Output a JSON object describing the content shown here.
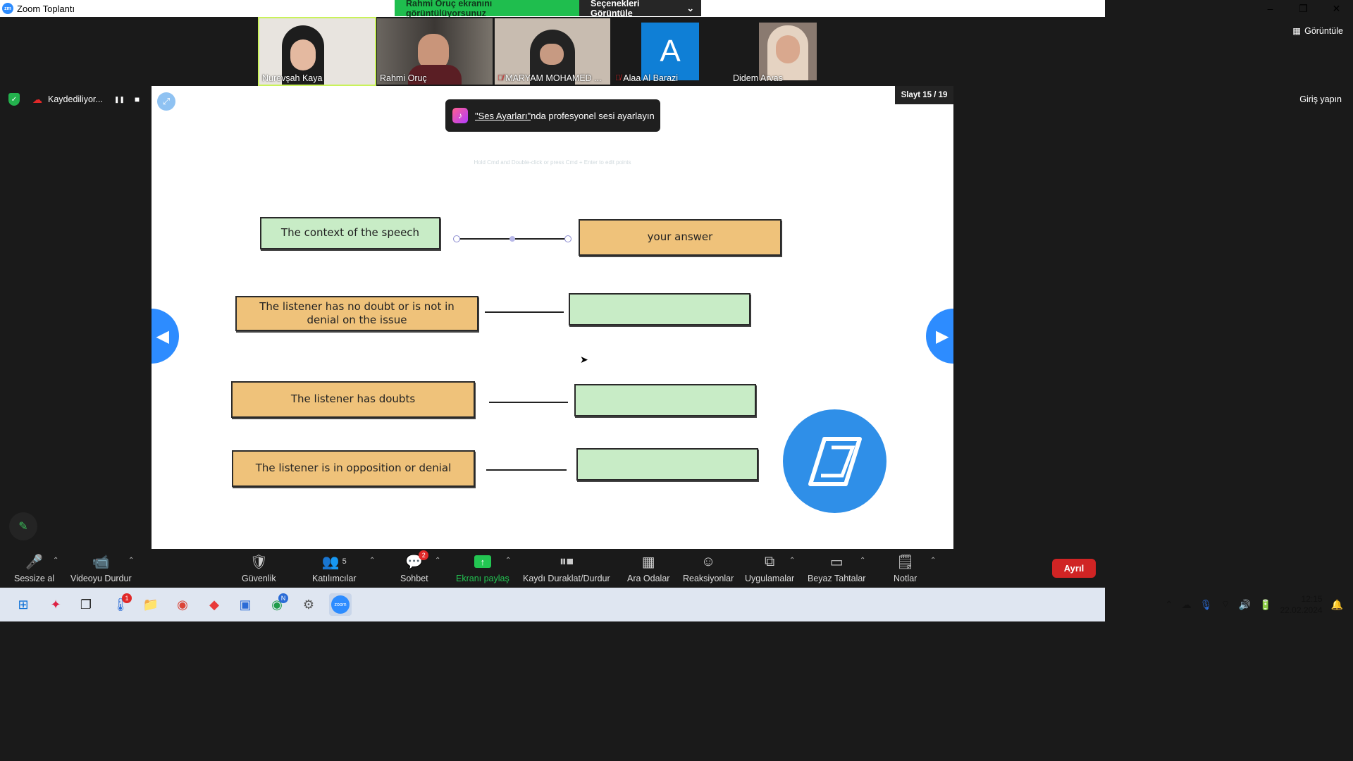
{
  "window": {
    "title": "Zoom Toplantı",
    "app_icon": "zm"
  },
  "share_banner": {
    "status": "Rahmi Oruç ekranını görüntülüyorsunuz",
    "options_label": "Seçenekleri Görüntüle"
  },
  "window_controls": {
    "minimize": "–",
    "restore": "❐",
    "close": "✕"
  },
  "participants": [
    {
      "name": "Nurevşah Kaya",
      "muted": false,
      "active": true,
      "tile_color": "#e8e4df"
    },
    {
      "name": "Rahmi Oruç",
      "muted": false,
      "active": false,
      "tile_color": "#5a5550"
    },
    {
      "name": "MARYAM MOHAMED ...",
      "muted": true,
      "active": false,
      "tile_color": "#b8a89c"
    },
    {
      "name": "Alaa Al Barazi",
      "muted": true,
      "active": false,
      "avatar_letter": "A",
      "tile_color": "#0f7fd6"
    },
    {
      "name": "Didem Arvas",
      "muted": false,
      "active": false,
      "tile_color": "#8a7a70"
    }
  ],
  "view_button": "Görüntüle",
  "recording": {
    "status": "Kaydediliyor...",
    "pause": "❚❚",
    "stop": "■"
  },
  "sign_in": "Giriş yapın",
  "slide": {
    "counter": "Slayt 15 / 19",
    "toast_prefix": "\"Ses Ayarları\"",
    "toast_suffix": "nda profesyonel sesi ayarlayın",
    "hint": "Hold Cmd and Double-click or press Cmd + Enter to edit points",
    "rows": [
      {
        "left": "The context of the speech",
        "right": "your answer"
      },
      {
        "left": "The listener has no doubt or is not in denial on the issue",
        "right": ""
      },
      {
        "left": "The listener has doubts",
        "right": ""
      },
      {
        "left": "The listener is in opposition or denial",
        "right": ""
      }
    ]
  },
  "toolbar": {
    "mute": "Sessize al",
    "video": "Videoyu Durdur",
    "security": "Güvenlik",
    "participants": "Katılımcılar",
    "participants_count": "5",
    "chat": "Sohbet",
    "chat_badge": "2",
    "share": "Ekranı paylaş",
    "record": "Kaydı Duraklat/Durdur",
    "breakout": "Ara Odalar",
    "reactions": "Reaksiyonlar",
    "apps": "Uygulamalar",
    "whiteboards": "Beyaz Tahtalar",
    "notes": "Notlar",
    "leave": "Ayrıl"
  },
  "taskbar": {
    "time": "12:15",
    "date": "22.02.2024",
    "notification_badge": "1",
    "chrome_badge": "N"
  }
}
